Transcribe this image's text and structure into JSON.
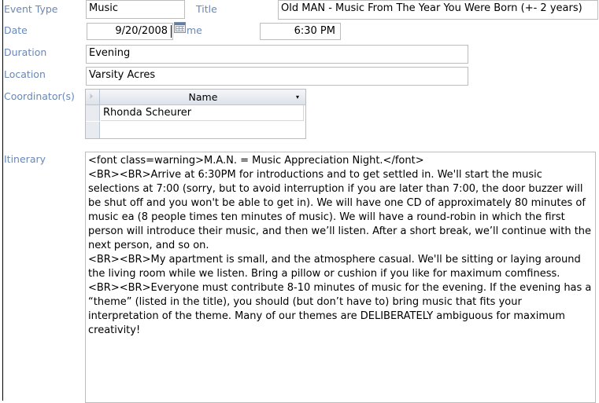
{
  "labels": {
    "event_type": "Event Type",
    "title": "Title",
    "date": "Date",
    "time": "me",
    "duration": "Duration",
    "location": "Location",
    "coordinators": "Coordinator(s)",
    "itinerary": "Itinerary"
  },
  "fields": {
    "event_type": "Music",
    "title": "Old MAN - Music From The Year You Were Born (+- 2 years)",
    "date": "9/20/2008",
    "time": "6:30 PM",
    "duration": "Evening",
    "location": "Varsity Acres"
  },
  "coordinators": {
    "column_header": "Name",
    "dropdown_glyph": "▾",
    "rows": [
      "Rhonda Scheurer"
    ]
  },
  "icons": {
    "date_picker": "calendar-icon",
    "column_dropdown": "chevron-down-icon",
    "select_all": "select-all-triangle-icon"
  },
  "itinerary_paragraphs": [
    "<font class=warning>M.A.N. = Music Appreciation Night.</font>",
    "<BR><BR>Arrive at 6:30PM for introductions and to get settled in.  We'll start the music selections at 7:00 (sorry, but to avoid interruption if you are later than 7:00, the door buzzer will be shut off and you won't be able to get in).  We will have one CD of approximately 80 minutes of music ea (8 people times ten minutes of music).  We will have a round-robin in which the first person will introduce their music, and then we’ll listen.  After a short break, we’ll continue with the next person, and so on.",
    "<BR><BR>My apartment is small, and the atmosphere casual.  We'll be sitting or laying around the living room while we listen.  Bring a pillow or cushion if you like for maximum comfiness.",
    "<BR><BR>Everyone must contribute 8-10 minutes of music for the evening.  If the evening has a “theme” (listed in the title), you should (but don’t have to) bring music that fits your interpretation of the theme.  Many of our themes are DELIBERATELY ambiguous for maximum creativity!"
  ],
  "colors": {
    "label": "#6a88b5",
    "border": "#bcbcbc",
    "header_gradient_top": "#f4f6f9",
    "header_gradient_bottom": "#dde3ea"
  }
}
